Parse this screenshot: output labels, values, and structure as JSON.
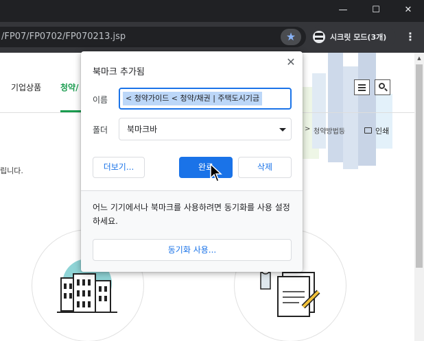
{
  "browser": {
    "url": "/FP07/FP0702/FP070213.jsp",
    "incognito_label": "시크릿 모드(3개)",
    "window_buttons": {
      "minimize": "—",
      "maximize": "☐",
      "close": "✕"
    },
    "star_icon": "★",
    "menu_icon": "⋮"
  },
  "page": {
    "nav": {
      "item1": "기업상품",
      "item2": "청약/"
    },
    "breadcrumb": {
      "item": "청약방법등",
      "separator": ">"
    },
    "print_label": "인쇄",
    "body_text": "립니다."
  },
  "dialog": {
    "title": "북마크 추가됨",
    "close_icon": "✕",
    "name_label": "이름",
    "name_value": "< 청약가이드 < 청약/채권 | 주택도시기금",
    "folder_label": "폴더",
    "folder_value": "북마크바",
    "more_button": "더보기...",
    "done_button": "완료",
    "delete_button": "삭제",
    "sync_message": "어느 기기에서나 북마크를 사용하려면 동기화를 사용 설정하세요.",
    "sync_button": "동기화 사용..."
  },
  "colors": {
    "accent": "#1a73e8",
    "nav_active": "#1a9c4f",
    "chrome_dark": "#202124",
    "chrome_toolbar": "#35363a"
  }
}
